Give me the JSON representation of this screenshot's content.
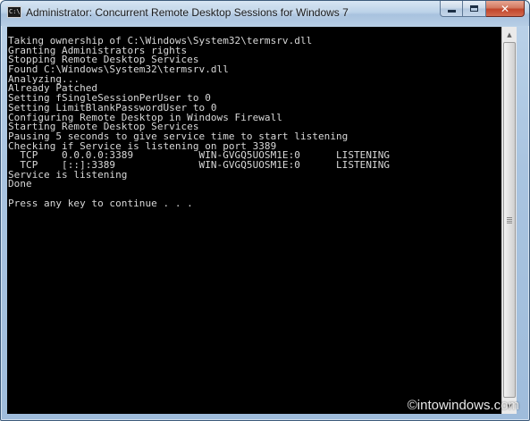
{
  "window": {
    "title": "Administrator:  Concurrent Remote Desktop Sessions for Windows 7",
    "icon": "cmd-console-icon",
    "icon_glyph": "C:\\",
    "buttons": {
      "minimize": "minimize-icon",
      "maximize": "maximize-icon",
      "close_glyph": "✕"
    }
  },
  "console": {
    "background": "#000000",
    "foreground": "#d8d8d8",
    "lines": [
      "Taking ownership of C:\\Windows\\System32\\termsrv.dll",
      "Granting Administrators rights",
      "Stopping Remote Desktop Services",
      "Found C:\\Windows\\System32\\termsrv.dll",
      "Analyzing...",
      "Already Patched",
      "Setting fSingleSessionPerUser to 0",
      "Setting LimitBlankPasswordUser to 0",
      "Configuring Remote Desktop in Windows Firewall",
      "Starting Remote Desktop Services",
      "Pausing 5 seconds to give service time to start listening",
      "Checking if Service is listening on port 3389",
      "  TCP    0.0.0.0:3389           WIN-GVGQ5UOSM1E:0      LISTENING",
      "  TCP    [::]:3389              WIN-GVGQ5UOSM1E:0      LISTENING",
      "Service is listening",
      "Done",
      "",
      "Press any key to continue . . ."
    ]
  },
  "scrollbar": {
    "up_arrow": "▲",
    "down_arrow": "▼"
  },
  "watermark": "©intowindows.com"
}
